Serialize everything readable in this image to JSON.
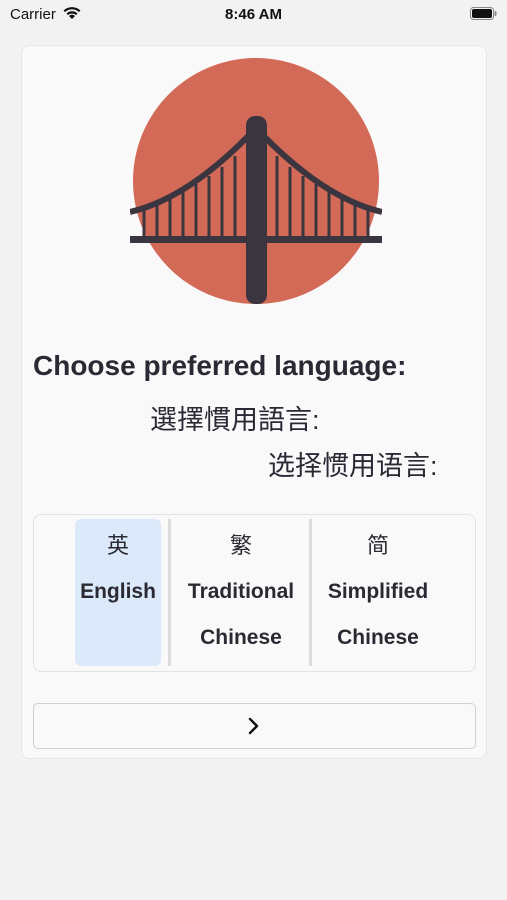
{
  "status_bar": {
    "carrier": "Carrier",
    "time": "8:46 AM"
  },
  "logo": {
    "icon": "golden-gate-bridge-icon",
    "circle_color": "#d36a57",
    "bridge_color": "#3b3540"
  },
  "heading": {
    "english": "Choose preferred language:",
    "traditional_chinese": "選擇慣用語言:",
    "simplified_chinese": "选择惯用语言:"
  },
  "language_options": [
    {
      "char": "英",
      "label_line1": "English",
      "label_line2": "",
      "selected": true
    },
    {
      "char": "繁",
      "label_line1": "Traditional",
      "label_line2": "Chinese",
      "selected": false
    },
    {
      "char": "简",
      "label_line1": "Simplified",
      "label_line2": "Chinese",
      "selected": false
    }
  ],
  "next_button": {
    "icon": "chevron-right-icon"
  },
  "colors": {
    "selected_bg": "#dbe9fb",
    "page_bg": "#f2f2f3",
    "text": "#2b2a33"
  }
}
